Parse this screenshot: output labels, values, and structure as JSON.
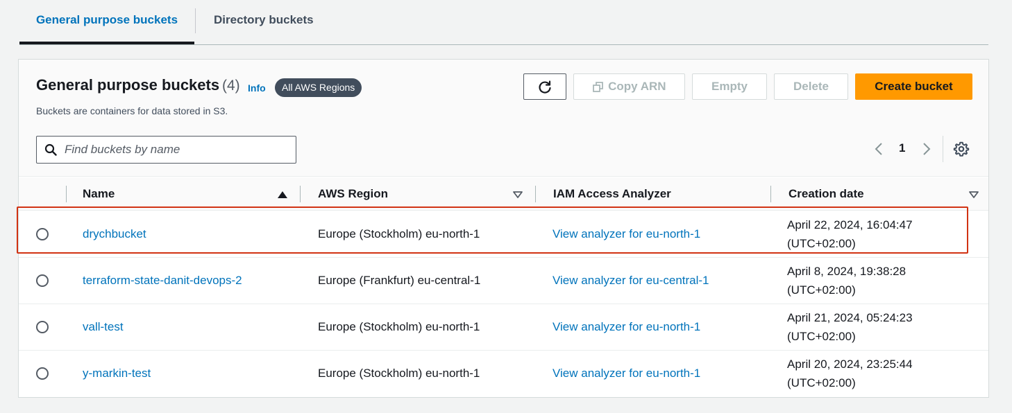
{
  "tabs": [
    {
      "label": "General purpose buckets",
      "active": true
    },
    {
      "label": "Directory buckets",
      "active": false
    }
  ],
  "header": {
    "title": "General purpose buckets",
    "count": "(4)",
    "info": "Info",
    "region_badge": "All AWS Regions",
    "description": "Buckets are containers for data stored in S3."
  },
  "toolbar": {
    "refresh_icon": "refresh-icon",
    "copy_arn": "Copy ARN",
    "empty": "Empty",
    "delete": "Delete",
    "create": "Create bucket"
  },
  "search": {
    "placeholder": "Find buckets by name",
    "value": ""
  },
  "pagination": {
    "current_page": "1"
  },
  "table": {
    "columns": [
      "Name",
      "AWS Region",
      "IAM Access Analyzer",
      "Creation date"
    ],
    "rows": [
      {
        "name": "drychbucket",
        "region": "Europe (Stockholm) eu-north-1",
        "analyzer": "View analyzer for eu-north-1",
        "date": "April 22, 2024, 16:04:47",
        "tz": "(UTC+02:00)"
      },
      {
        "name": "terraform-state-danit-devops-2",
        "region": "Europe (Frankfurt) eu-central-1",
        "analyzer": "View analyzer for eu-central-1",
        "date": "April 8, 2024, 19:38:28",
        "tz": "(UTC+02:00)"
      },
      {
        "name": "vall-test",
        "region": "Europe (Stockholm) eu-north-1",
        "analyzer": "View analyzer for eu-north-1",
        "date": "April 21, 2024, 05:24:23",
        "tz": "(UTC+02:00)"
      },
      {
        "name": "y-markin-test",
        "region": "Europe (Stockholm) eu-north-1",
        "analyzer": "View analyzer for eu-north-1",
        "date": "April 20, 2024, 23:25:44",
        "tz": "(UTC+02:00)"
      }
    ]
  },
  "colors": {
    "accent": "#0073bb",
    "primary_button": "#ff9900",
    "highlight": "#d13212"
  }
}
